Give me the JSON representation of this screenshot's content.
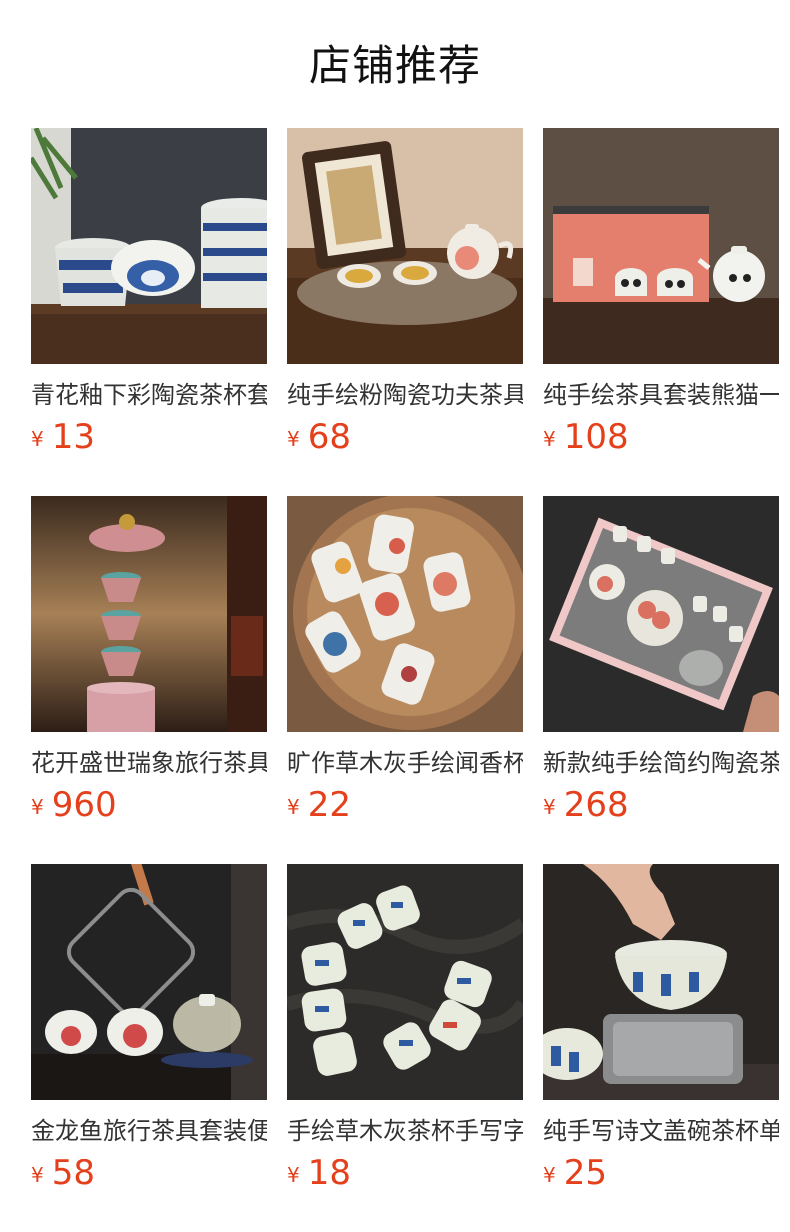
{
  "page": {
    "title": "店铺推荐"
  },
  "colors": {
    "price": "#e4401c",
    "name_text": "#333333",
    "title_text": "#111111"
  },
  "products": [
    {
      "name": "青花釉下彩陶瓷茶杯套装",
      "currency": "¥",
      "price": "13",
      "image": "blue-white-porcelain-cups-image"
    },
    {
      "name": "纯手绘粉陶瓷功夫茶具套装",
      "currency": "¥",
      "price": "68",
      "image": "peach-teapot-set-image"
    },
    {
      "name": "纯手绘茶具套装熊猫一壶两杯",
      "currency": "¥",
      "price": "108",
      "image": "panda-tea-set-image"
    },
    {
      "name": "花开盛世瑞象旅行茶具套装",
      "currency": "¥",
      "price": "960",
      "image": "enamel-stacked-cups-image"
    },
    {
      "name": "旷作草木灰手绘闻香杯品茗杯",
      "currency": "¥",
      "price": "22",
      "image": "flower-cups-tray-image"
    },
    {
      "name": "新款纯手绘简约陶瓷茶具套装",
      "currency": "¥",
      "price": "268",
      "image": "gift-box-tea-set-image"
    },
    {
      "name": "金龙鱼旅行茶具套装便携",
      "currency": "¥",
      "price": "58",
      "image": "koi-travel-set-image"
    },
    {
      "name": "手绘草木灰茶杯手写字品茗杯",
      "currency": "¥",
      "price": "18",
      "image": "calligraphy-cups-image"
    },
    {
      "name": "纯手写诗文盖碗茶杯单个",
      "currency": "¥",
      "price": "25",
      "image": "poem-gaiwan-image"
    }
  ]
}
